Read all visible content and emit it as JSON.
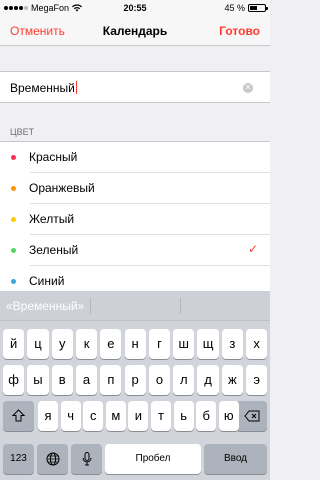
{
  "status_bar": {
    "carrier": "MegaFon",
    "time": "20:55",
    "battery_text": "45 %",
    "battery_level": 0.45
  },
  "nav": {
    "cancel": "Отменить",
    "title": "Календарь",
    "done": "Готово"
  },
  "name_field": {
    "value": "Временный"
  },
  "colors_section": {
    "header": "ЦВЕТ",
    "items": [
      {
        "label": "Красный",
        "color": "#ff2d55",
        "selected": false
      },
      {
        "label": "Оранжевый",
        "color": "#ff9500",
        "selected": false
      },
      {
        "label": "Желтый",
        "color": "#ffcc00",
        "selected": false
      },
      {
        "label": "Зеленый",
        "color": "#4cd964",
        "selected": true
      },
      {
        "label": "Синий",
        "color": "#34aadc",
        "selected": false
      }
    ],
    "checkmark": "✓"
  },
  "keyboard": {
    "suggestion": "«Временный»",
    "row1": [
      "й",
      "ц",
      "у",
      "к",
      "е",
      "н",
      "г",
      "ш",
      "щ",
      "з",
      "х"
    ],
    "row2": [
      "ф",
      "ы",
      "в",
      "а",
      "п",
      "р",
      "о",
      "л",
      "д",
      "ж",
      "э"
    ],
    "row3": [
      "я",
      "ч",
      "с",
      "м",
      "и",
      "т",
      "ь",
      "б",
      "ю"
    ],
    "numbers_key": "123",
    "space_key": "Пробел",
    "return_key": "Ввод"
  },
  "accent_color": "#ff3b30"
}
